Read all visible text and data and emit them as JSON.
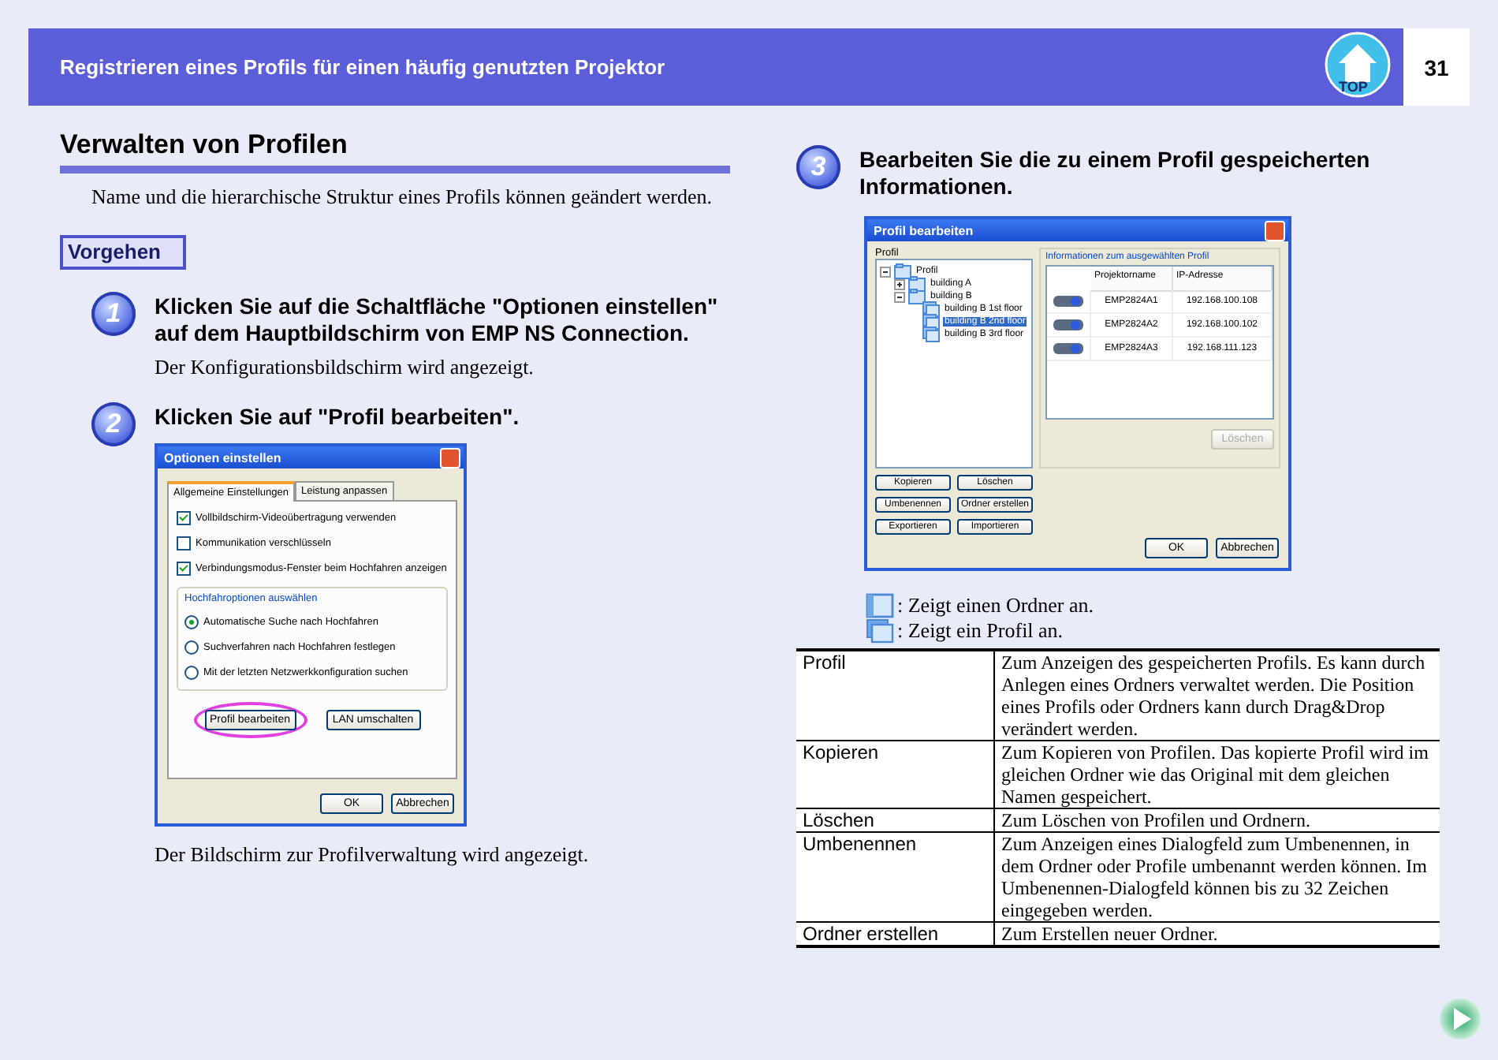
{
  "header": {
    "title": "Registrieren eines Profils für einen häufig genutzten Projektor",
    "top_label": "TOP",
    "page_number": "31"
  },
  "section": {
    "title": "Verwalten von Profilen",
    "intro": "Name und die hierarchische Struktur eines Profils können geändert werden."
  },
  "procedure_label": "Vorgehen",
  "steps": [
    {
      "number": "1",
      "title": "Klicken Sie auf die Schaltfläche \"Optionen einstellen\" auf dem Hauptbildschirm von EMP NS Connection.",
      "note": "Der Konfigurationsbildschirm wird angezeigt."
    },
    {
      "number": "2",
      "title": "Klicken Sie auf \"Profil bearbeiten\".",
      "note": "Der Bildschirm zur Profilverwaltung wird angezeigt."
    },
    {
      "number": "3",
      "title": "Bearbeiten Sie die zu einem Profil gespeicherten Informationen."
    }
  ],
  "options_dialog": {
    "title": "Optionen einstellen",
    "tabs": [
      {
        "label": "Allgemeine Einstellungen",
        "selected": true
      },
      {
        "label": "Leistung anpassen",
        "selected": false
      }
    ],
    "checkboxes": [
      {
        "label": "Vollbildschirm-Videoübertragung verwenden",
        "checked": true
      },
      {
        "label": "Kommunikation verschlüsseln",
        "checked": false
      },
      {
        "label": "Verbindungsmodus-Fenster beim Hochfahren anzeigen",
        "checked": true
      }
    ],
    "group_title": "Hochfahroptionen auswählen",
    "radios": [
      {
        "label": "Automatische Suche nach Hochfahren",
        "selected": true
      },
      {
        "label": "Suchverfahren nach Hochfahren festlegen",
        "selected": false
      },
      {
        "label": "Mit der letzten Netzwerkkonfiguration suchen",
        "selected": false
      }
    ],
    "buttons": [
      {
        "label": "Profil bearbeiten",
        "highlighted": true
      },
      {
        "label": "LAN umschalten",
        "highlighted": false
      }
    ],
    "footer_buttons": [
      "OK",
      "Abbrechen"
    ]
  },
  "profile_dialog": {
    "title": "Profil bearbeiten",
    "tree_label": "Profil",
    "tree": [
      {
        "label": "Profil",
        "kind": "folder",
        "expanded": true,
        "selected": false,
        "children": [
          {
            "label": "building A",
            "kind": "folder",
            "expanded": false,
            "selected": false
          },
          {
            "label": "building B",
            "kind": "folder",
            "expanded": true,
            "selected": false,
            "children": [
              {
                "label": "building B 1st floor",
                "kind": "profile",
                "selected": false
              },
              {
                "label": "building B 2nd floor",
                "kind": "profile",
                "selected": true
              },
              {
                "label": "building B 3rd floor",
                "kind": "profile",
                "selected": false
              }
            ]
          }
        ]
      }
    ],
    "info_title": "Informationen zum ausgewählten Profil",
    "columns": [
      "Projektorname",
      "IP-Adresse"
    ],
    "rows": [
      {
        "name": "EMP2824A1",
        "ip": "192.168.100.108"
      },
      {
        "name": "EMP2824A2",
        "ip": "192.168.100.102"
      },
      {
        "name": "EMP2824A3",
        "ip": "192.168.111.123"
      }
    ],
    "delete_button": {
      "label": "Löschen",
      "disabled": true
    },
    "buttons": [
      "Kopieren",
      "Löschen",
      "Umbenennen",
      "Ordner erstellen",
      "Exportieren",
      "Importieren"
    ],
    "footer_buttons": [
      "OK",
      "Abbrechen"
    ]
  },
  "legend": [
    {
      "kind": "folder",
      "text": ": Zeigt einen Ordner an."
    },
    {
      "kind": "profile",
      "text": ": Zeigt ein Profil an."
    }
  ],
  "table": [
    {
      "term": "Profil",
      "description": "Zum Anzeigen des gespeicherten Profils. Es kann durch Anlegen eines Ordners verwaltet werden. Die Position eines Profils oder Ordners kann durch Drag&Drop verändert werden."
    },
    {
      "term": "Kopieren",
      "description": "Zum Kopieren von Profilen. Das kopierte Profil wird im gleichen Ordner wie das Original mit dem gleichen Namen gespeichert."
    },
    {
      "term": "Löschen",
      "description": "Zum Löschen von Profilen und Ordnern."
    },
    {
      "term": "Umbenennen",
      "description": "Zum Anzeigen eines Dialogfeld zum Umbenennen, in dem Ordner oder Profile umbenannt werden können. Im Umbenennen-Dialogfeld können bis zu 32 Zeichen eingegeben werden."
    },
    {
      "term": "Ordner erstellen",
      "description": "Zum Erstellen neuer Ordner."
    }
  ]
}
